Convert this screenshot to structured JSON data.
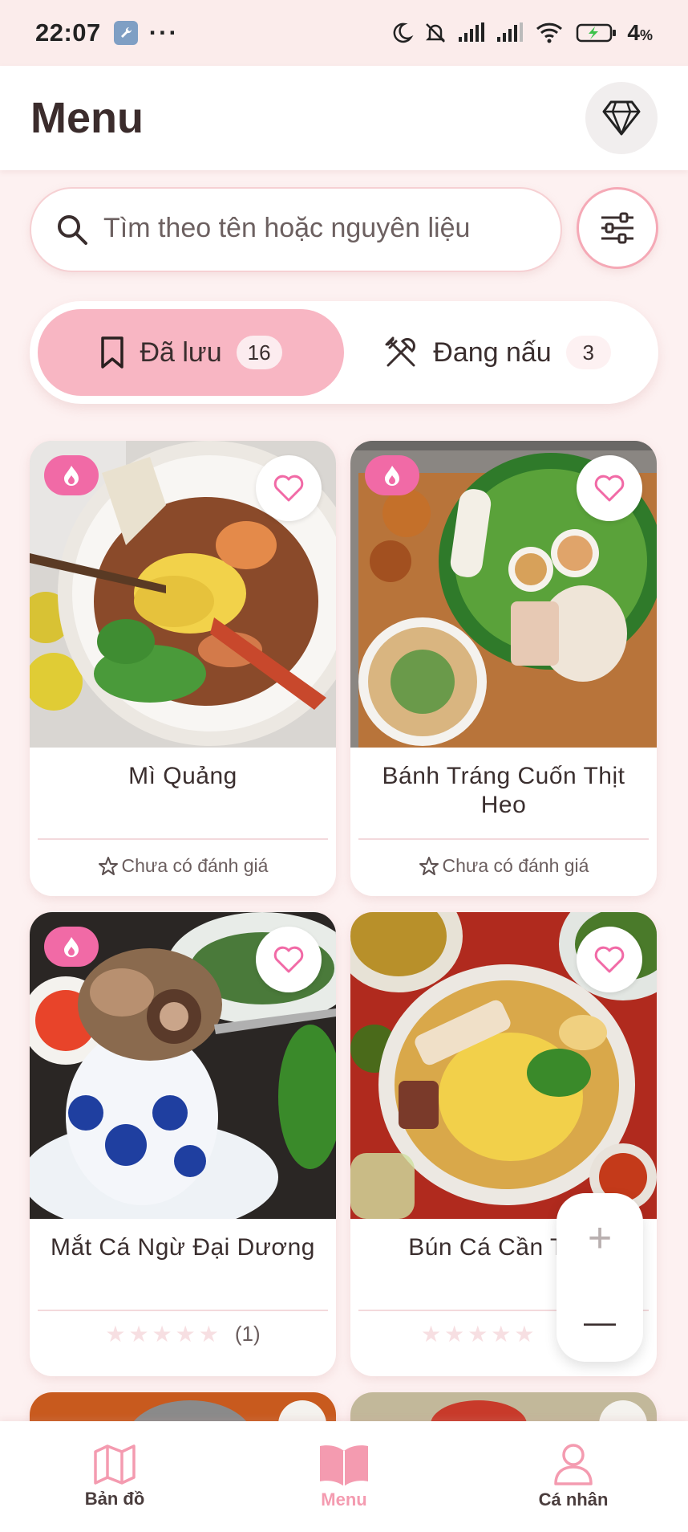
{
  "status_bar": {
    "time": "22:07",
    "battery": "4",
    "battery_unit": "%",
    "network": "6"
  },
  "header": {
    "title": "Menu",
    "premium_icon": "diamond-icon"
  },
  "search": {
    "placeholder": "Tìm theo tên hoặc nguyên liệu"
  },
  "tabs": [
    {
      "label": "Đã lưu",
      "count": "16",
      "icon": "bookmark-icon",
      "active": true
    },
    {
      "label": "Đang nấu",
      "count": "3",
      "icon": "utensils-icon",
      "active": false
    }
  ],
  "recipes": [
    {
      "name": "Mì Quảng",
      "rating": "Chưa có đánh giá",
      "hot": true
    },
    {
      "name": "Bánh Tráng Cuốn Thịt Heo",
      "rating": "Chưa có đánh giá",
      "hot": true
    },
    {
      "name": "Mắt Cá Ngừ Đại Dương",
      "rating_count": "(1)",
      "hot": true
    },
    {
      "name": "Bún Cá Cần T",
      "rating_count": "",
      "hot": false
    }
  ],
  "zoom": {
    "plus": "+",
    "minus": "—"
  },
  "bottom_nav": [
    {
      "label": "Bản đồ",
      "icon": "map-icon",
      "active": false
    },
    {
      "label": "Menu",
      "icon": "book-icon",
      "active": true
    },
    {
      "label": "Cá nhân",
      "icon": "person-icon",
      "active": false
    }
  ],
  "colors": {
    "accent": "#f49bb0",
    "tab_active": "#f8b6c3",
    "badge": "#f16aa6",
    "background": "#fdf1f1"
  }
}
